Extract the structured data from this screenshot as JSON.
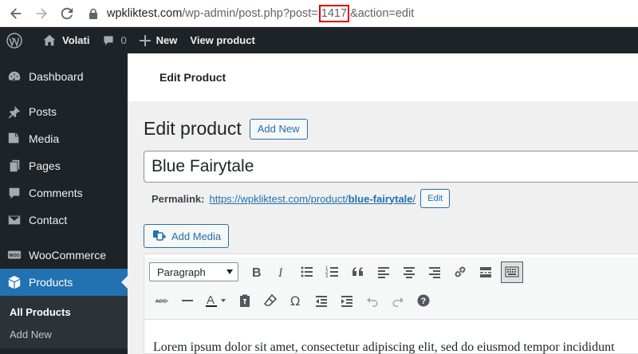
{
  "browser": {
    "url_domain": "wpkliktest.com",
    "url_before": "/wp-admin/post.php?post=",
    "url_post_id": "1417",
    "url_after": "&action=edit"
  },
  "adminbar": {
    "site_name": "Volati",
    "comments_count": "0",
    "new_label": "New",
    "view_label": "View product"
  },
  "sidebar": {
    "items": [
      {
        "label": "Dashboard",
        "icon": "dashboard-icon"
      },
      {
        "label": "Posts",
        "icon": "pin-icon"
      },
      {
        "label": "Media",
        "icon": "media-icon"
      },
      {
        "label": "Pages",
        "icon": "pages-icon"
      },
      {
        "label": "Comments",
        "icon": "comment-icon"
      },
      {
        "label": "Contact",
        "icon": "mail-icon"
      },
      {
        "label": "WooCommerce",
        "icon": "woo-icon"
      },
      {
        "label": "Products",
        "icon": "box-icon"
      }
    ],
    "submenu": [
      "All Products",
      "Add New"
    ]
  },
  "header": {
    "title": "Edit Product"
  },
  "main": {
    "page_title": "Edit product",
    "add_new_label": "Add New",
    "product_title": "Blue Fairytale",
    "permalink_label": "Permalink:",
    "permalink_base": "https://wpkliktest.com/product/",
    "permalink_slug": "blue-fairytale",
    "permalink_tail": "/",
    "permalink_edit_label": "Edit",
    "add_media_label": "Add Media"
  },
  "editor": {
    "format_value": "Paragraph",
    "content": "Lorem ipsum dolor sit amet, consectetur adipiscing elit, sed do eiusmod tempor incididunt"
  },
  "colors": {
    "admin_bar": "#1d2327",
    "accent": "#2271b1",
    "highlight_box": "#dd0000"
  }
}
